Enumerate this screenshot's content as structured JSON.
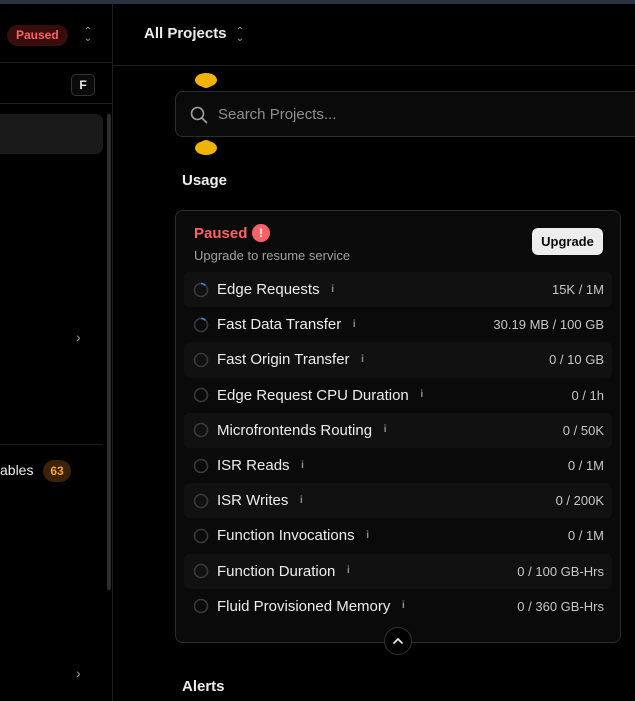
{
  "sidebar": {
    "status_badge": "Paused",
    "shortcut_key": "F",
    "nav_label_partial": "ables",
    "nav_count": "63"
  },
  "header": {
    "project_switcher": "All Projects"
  },
  "search": {
    "placeholder": "Search Projects..."
  },
  "usage": {
    "section_title": "Usage",
    "status_title": "Paused",
    "status_subtitle": "Upgrade to resume service",
    "upgrade_label": "Upgrade",
    "metrics": [
      {
        "label": "Edge Requests",
        "value": "15K / 1M",
        "progress": 0.015
      },
      {
        "label": "Fast Data Transfer",
        "value": "30.19 MB / 100 GB",
        "progress": 0.0003
      },
      {
        "label": "Fast Origin Transfer",
        "value": "0 / 10 GB",
        "progress": 0
      },
      {
        "label": "Edge Request CPU Duration",
        "value": "0 / 1h",
        "progress": 0
      },
      {
        "label": "Microfrontends Routing",
        "value": "0 / 50K",
        "progress": 0
      },
      {
        "label": "ISR Reads",
        "value": "0 / 1M",
        "progress": 0
      },
      {
        "label": "ISR Writes",
        "value": "0 / 200K",
        "progress": 0
      },
      {
        "label": "Function Invocations",
        "value": "0 / 1M",
        "progress": 0
      },
      {
        "label": "Function Duration",
        "value": "0 / 100 GB-Hrs",
        "progress": 0
      },
      {
        "label": "Fluid Provisioned Memory",
        "value": "0 / 360 GB-Hrs",
        "progress": 0
      }
    ]
  },
  "alerts": {
    "section_title": "Alerts"
  },
  "colors": {
    "danger": "#ff6166",
    "warning": "#f5a524",
    "accent_ring": "#3b82f6",
    "blob": "#f0b400"
  }
}
